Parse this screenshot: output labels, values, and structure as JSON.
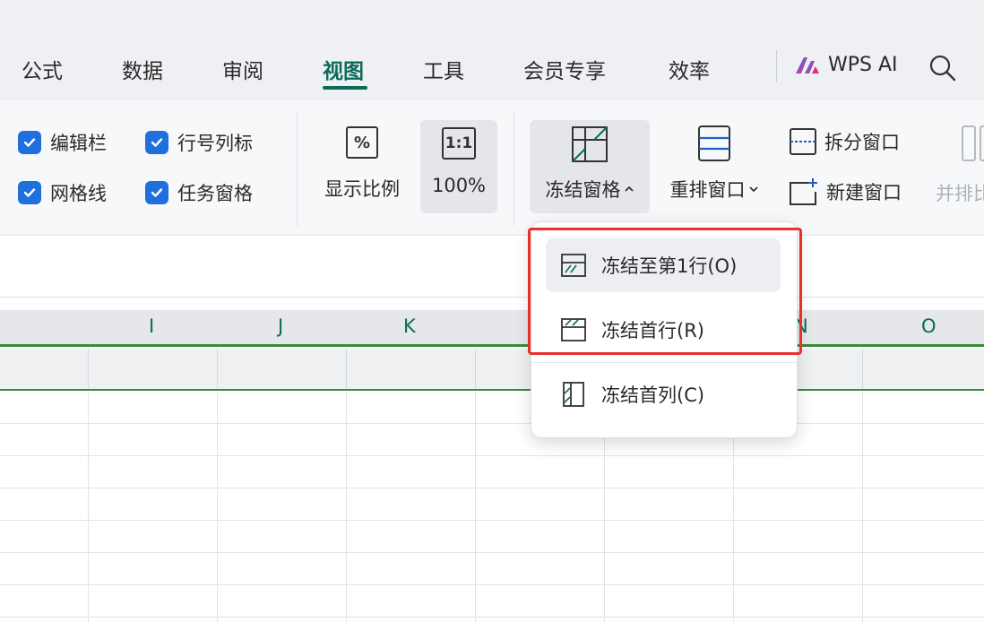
{
  "menu": {
    "tabs": [
      {
        "label": "公式"
      },
      {
        "label": "数据"
      },
      {
        "label": "审阅"
      },
      {
        "label": "视图"
      },
      {
        "label": "工具"
      },
      {
        "label": "会员专享"
      },
      {
        "label": "效率"
      }
    ],
    "active_tab": "视图",
    "wps_ai": "WPS AI"
  },
  "ribbon": {
    "checkboxes": [
      {
        "label": "编辑栏",
        "checked": true
      },
      {
        "label": "行号列标",
        "checked": true
      },
      {
        "label": "网格线",
        "checked": true
      },
      {
        "label": "任务窗格",
        "checked": true
      }
    ],
    "zoom_label": "显示比例",
    "zoom_icon_text": "%",
    "ratio_icon_text": "1:1",
    "zoom_value": "100%",
    "freeze_label": "冻结窗格",
    "rearrange_label": "重排窗口",
    "split_label": "拆分窗口",
    "new_window_label": "新建窗口",
    "side_by_side_label": "并排比"
  },
  "sheet": {
    "columns": [
      "I",
      "J",
      "K",
      "N",
      "O"
    ]
  },
  "dropdown": {
    "items": [
      {
        "label": "冻结至第1行(O)"
      },
      {
        "label": "冻结首行(R)"
      },
      {
        "label": "冻结首列(C)"
      }
    ]
  },
  "colors": {
    "accent": "#0d6b59",
    "checkbox": "#1f6fdc",
    "highlight": "#e8312a",
    "frozen_line": "#3a8a3a"
  }
}
